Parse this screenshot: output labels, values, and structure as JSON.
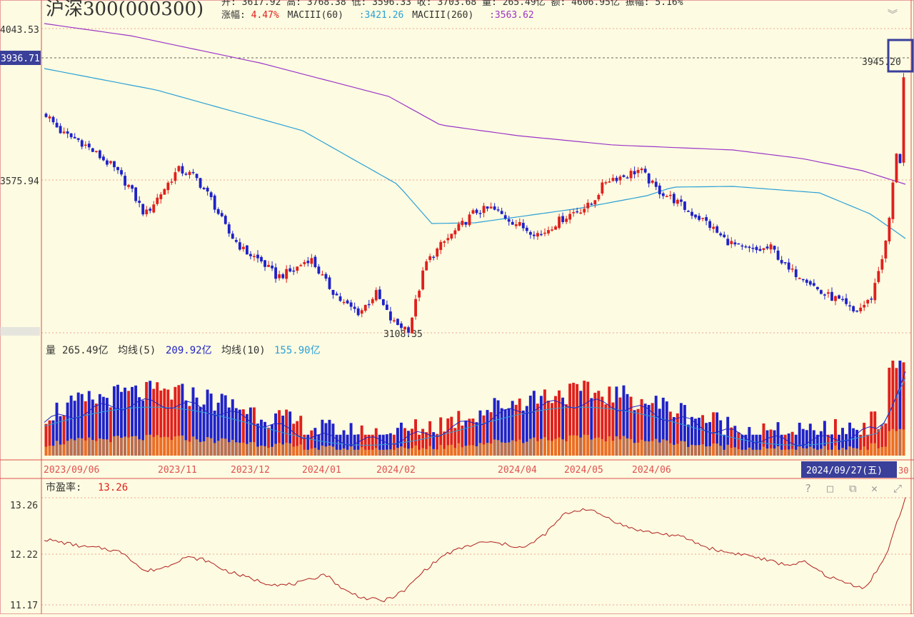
{
  "header": {
    "title": "沪深300(000300)",
    "line1": "开: 3617.92  高: 3768.38  低: 3596.33  收: 3703.68  量: 265.49亿  额: 4606.95亿  振幅: 5.16%",
    "change_label": "涨幅:",
    "change_value": "4.47%",
    "ma60_label": "MACIII(60)",
    "ma60_value": ":3421.26",
    "ma260_label": "MACIII(260)",
    "ma260_value": ":3563.62"
  },
  "colors": {
    "background": "#fdfbe1",
    "up": "#e0201c",
    "down": "#1f22c8",
    "ma60": "#2aa0d8",
    "ma260": "#9b35c9",
    "orange_volume": "#f08a24",
    "grid": "#e05050",
    "selected_date_bg": "#3a3f9a"
  },
  "price_panel": {
    "axis_labels": [
      "4043.53",
      "3936.71",
      "3575.94",
      "3108.35"
    ],
    "current_price_tag": "3936.71",
    "right_marker": "3945.20",
    "low_marker": "3108.35"
  },
  "volume_panel": {
    "vol_label": "量",
    "vol_value": "265.49亿",
    "ma5_label": "均线(5)",
    "ma5_value": "209.92亿",
    "ma10_label": "均线(10)",
    "ma10_value": "155.90亿"
  },
  "date_axis": {
    "labels": [
      "2023/09/06",
      "2023/11",
      "2023/12",
      "2024/01",
      "2024/02",
      "2024/04",
      "2024/05",
      "2024/06"
    ],
    "selected_date": "2024/09/27(五)",
    "edge_digits": "30"
  },
  "pe_panel": {
    "label": "市盈率:",
    "value": "13.26",
    "axis_labels": [
      "13.26",
      "12.22",
      "11.17"
    ]
  },
  "toolbar_icons": [
    "help-icon",
    "maximize-icon",
    "restore-icon",
    "close-icon",
    "popout-icon"
  ],
  "chart_data": [
    {
      "type": "candlestick",
      "title": "沪深300(000300)",
      "x_range": [
        "2023/09/06",
        "2024/09/30"
      ],
      "ylim": [
        3108.35,
        4043.53
      ],
      "approx_close": [
        3780,
        3720,
        3700,
        3660,
        3620,
        3560,
        3470,
        3540,
        3610,
        3590,
        3520,
        3420,
        3360,
        3330,
        3280,
        3300,
        3340,
        3260,
        3200,
        3170,
        3230,
        3140,
        3120,
        3320,
        3380,
        3430,
        3480,
        3490,
        3460,
        3430,
        3410,
        3450,
        3480,
        3500,
        3580,
        3590,
        3610,
        3550,
        3520,
        3480,
        3450,
        3400,
        3370,
        3360,
        3370,
        3300,
        3280,
        3230,
        3210,
        3170,
        3210,
        3400,
        3870
      ],
      "series": [
        {
          "name": "MACIII(60)",
          "last_value": 3421.26
        },
        {
          "name": "MACIII(260)",
          "last_value": 3563.62
        }
      ],
      "annotations": [
        {
          "label": "3108.35",
          "x": "2024/02"
        },
        {
          "label": "3945.20",
          "x": "2024/09/30"
        }
      ]
    },
    {
      "type": "bar",
      "title": "量",
      "unit": "亿",
      "last_value": 265.49,
      "series": [
        {
          "name": "均线(5)",
          "last_value": 209.92
        },
        {
          "name": "均线(10)",
          "last_value": 155.9
        }
      ]
    },
    {
      "type": "line",
      "title": "市盈率",
      "ylim": [
        11.17,
        13.26
      ],
      "last_value": 13.26,
      "approx_values": [
        12.45,
        12.38,
        12.3,
        12.27,
        12.18,
        11.82,
        11.9,
        12.1,
        12.05,
        11.85,
        11.72,
        11.6,
        11.55,
        11.62,
        11.78,
        11.45,
        11.3,
        11.25,
        11.45,
        11.85,
        12.15,
        12.3,
        12.4,
        12.35,
        12.28,
        12.55,
        12.95,
        13.05,
        12.9,
        12.7,
        12.6,
        12.55,
        12.48,
        12.3,
        12.2,
        12.15,
        12.05,
        11.95,
        12.0,
        11.75,
        11.6,
        11.5,
        12.1,
        13.26
      ]
    }
  ]
}
